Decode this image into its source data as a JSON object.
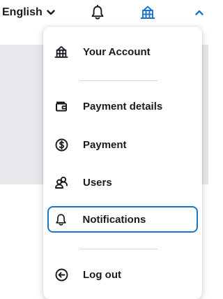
{
  "header": {
    "language_label": "English"
  },
  "menu": {
    "items": [
      {
        "label": "Your Account",
        "icon": "account-building-icon"
      },
      {
        "label": "Payment details",
        "icon": "wallet-icon"
      },
      {
        "label": "Payment",
        "icon": "dollar-circle-icon"
      },
      {
        "label": "Users",
        "icon": "users-icon"
      },
      {
        "label": "Notifications",
        "icon": "bell-icon",
        "focused": true
      },
      {
        "label": "Log out",
        "icon": "logout-icon"
      }
    ]
  },
  "colors": {
    "accent": "#1a73c8",
    "text": "#1b1b1f",
    "page_background": "#e6e8ec",
    "separator": "#d7d9de"
  }
}
